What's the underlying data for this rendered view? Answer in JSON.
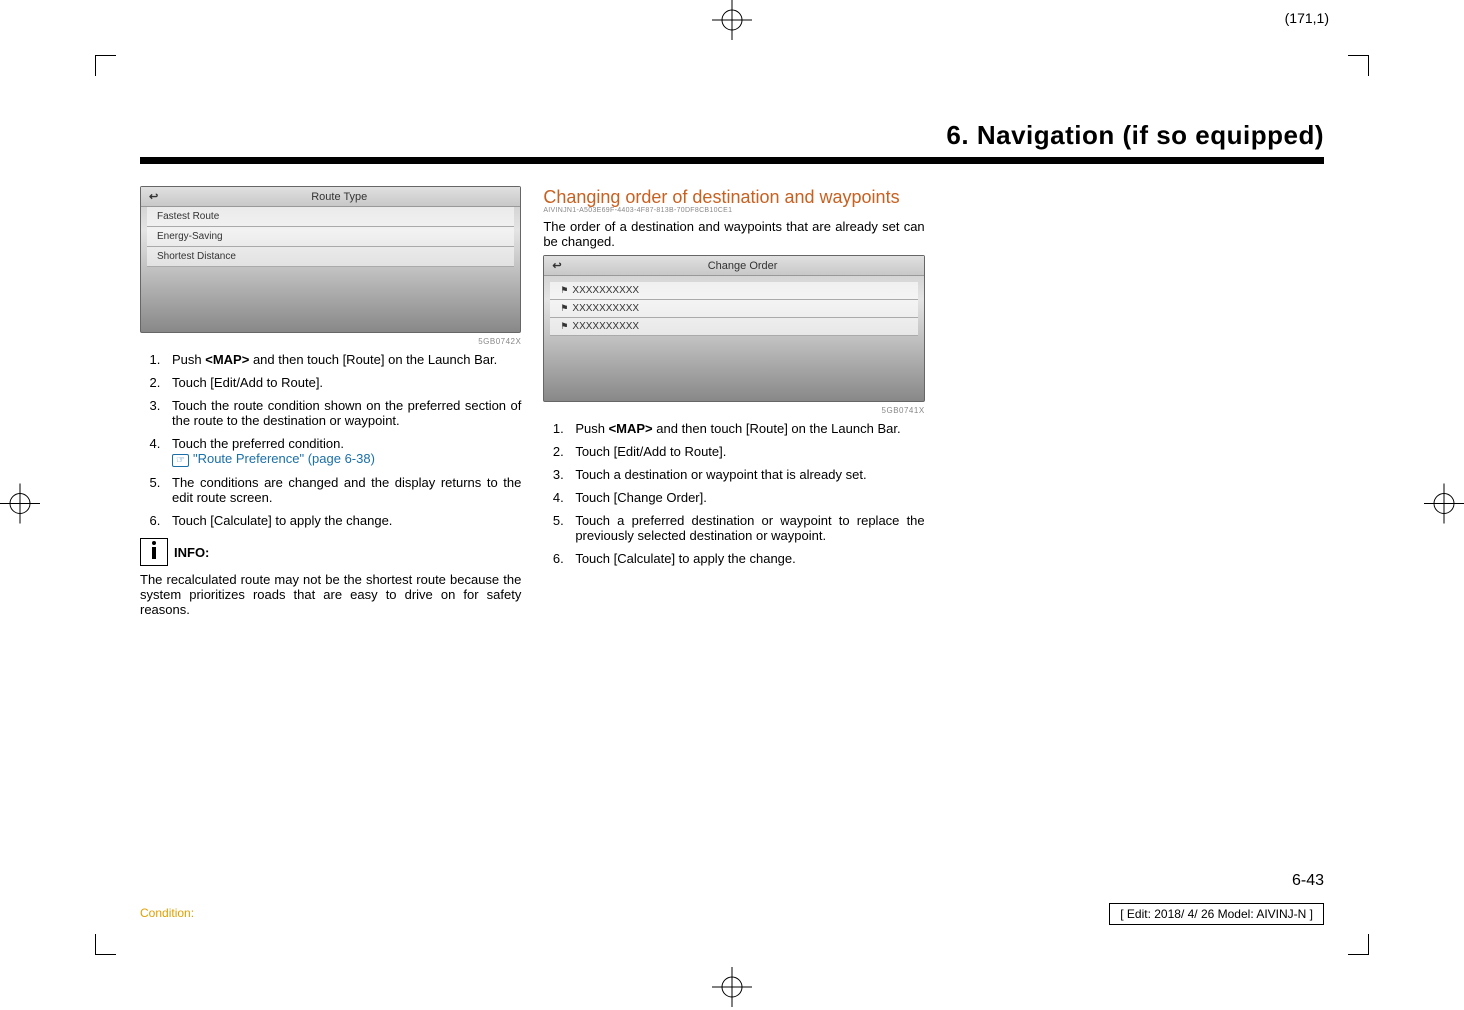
{
  "page_number_top": "(171,1)",
  "chapter_title": "6. Navigation (if so equipped)",
  "col1": {
    "screenshot": {
      "title": "Route Type",
      "rows": [
        "Fastest Route",
        "Energy-Saving",
        "Shortest Distance"
      ]
    },
    "img_code": "5GB0742X",
    "steps": [
      {
        "pre": "Push ",
        "bold": "<MAP>",
        "post": " and then touch [Route] on the Launch Bar."
      },
      {
        "text": "Touch [Edit/Add to Route]."
      },
      {
        "text": "Touch the route condition shown on the preferred section of the route to the destination or waypoint."
      },
      {
        "text": "Touch the preferred condition.",
        "xref": "\"Route Preference\" (page 6-38)"
      },
      {
        "text": "The conditions are changed and the display returns to the edit route screen."
      },
      {
        "text": "Touch [Calculate] to apply the change."
      }
    ],
    "info_label": "INFO:",
    "info_text": "The recalculated route may not be the shortest route because the system prioritizes roads that are easy to drive on for safety reasons."
  },
  "col2": {
    "subhead": "Changing order of destination and waypoints",
    "guid": "AIVINJN1-A503E69F-4403-4F87-813B-70DF8CB10CE1",
    "intro": "The order of a destination and waypoints that are already set can be changed.",
    "screenshot": {
      "title": "Change Order",
      "rows": [
        "XXXXXXXXXX",
        "XXXXXXXXXX",
        "XXXXXXXXXX"
      ]
    },
    "img_code": "5GB0741X",
    "steps": [
      {
        "pre": "Push ",
        "bold": "<MAP>",
        "post": " and then touch [Route] on the Launch Bar."
      },
      {
        "text": "Touch [Edit/Add to Route]."
      },
      {
        "text": "Touch a destination or waypoint that is already set."
      },
      {
        "text": "Touch [Change Order]."
      },
      {
        "text": "Touch a preferred destination or waypoint to replace the previously selected destination or waypoint."
      },
      {
        "text": "Touch [Calculate] to apply the change."
      }
    ]
  },
  "page_number_bottom": "6-43",
  "condition_label": "Condition:",
  "edit_info": "[ Edit: 2018/ 4/ 26   Model: AIVINJ-N ]"
}
